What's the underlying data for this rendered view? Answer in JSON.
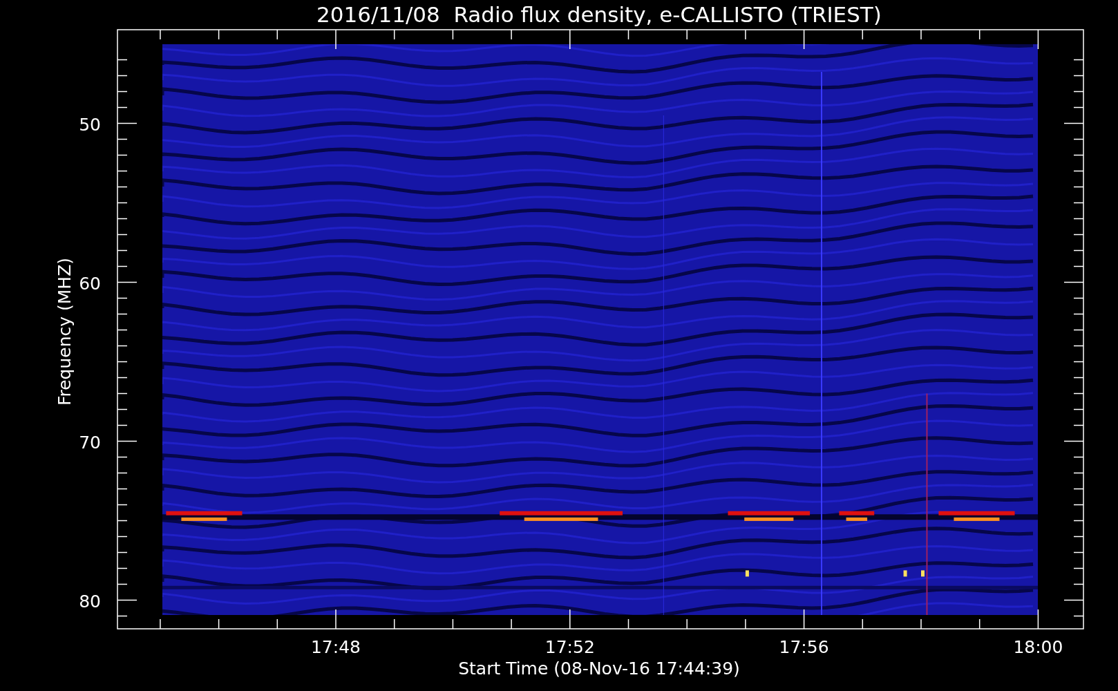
{
  "title": "2016/11/08  Radio flux density, e-CALLISTO (TRIEST)",
  "ylabel": "Frequency (MHZ)",
  "xlabel": "Start Time (08-Nov-16 17:44:39)",
  "yticks": [
    "50",
    "60",
    "70",
    "80"
  ],
  "xticks": [
    "17:48",
    "17:52",
    "17:56",
    "18:00"
  ]
}
